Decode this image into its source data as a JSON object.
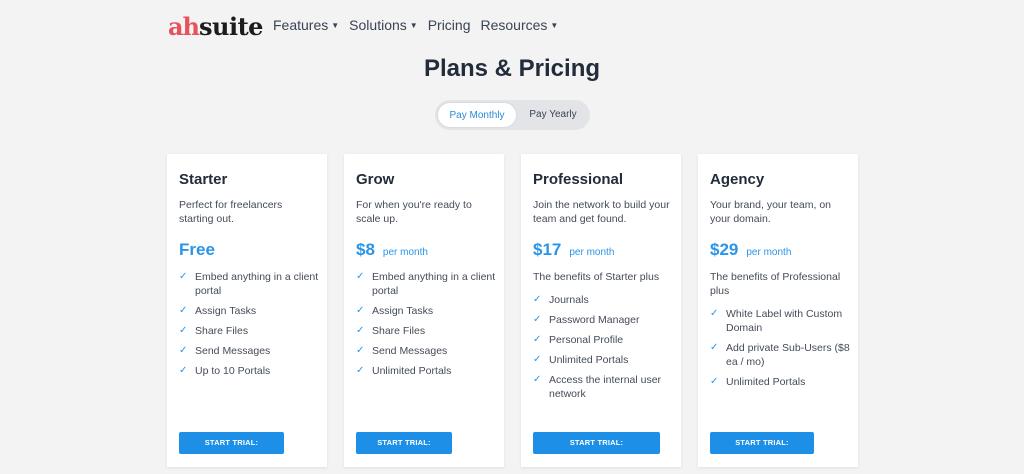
{
  "header": {
    "logo_mark": "ah",
    "logo_text": "suite",
    "nav": [
      {
        "label": "Features",
        "has_caret": true
      },
      {
        "label": "Solutions",
        "has_caret": true
      },
      {
        "label": "Pricing",
        "has_caret": false
      },
      {
        "label": "Resources",
        "has_caret": true
      }
    ]
  },
  "page_title": "Plans & Pricing",
  "billing_toggle": {
    "monthly_label": "Pay Monthly",
    "yearly_label": "Pay Yearly",
    "selected": "monthly"
  },
  "plans": [
    {
      "name": "Starter",
      "description": "Perfect for freelancers starting out.",
      "price": "Free",
      "period": "",
      "benefits_intro": "",
      "features": [
        "Embed anything in a client portal",
        "Assign Tasks",
        "Share Files",
        "Send Messages",
        "Up to 10 Portals"
      ],
      "cta": "START TRIAL: STARTER"
    },
    {
      "name": "Grow",
      "description": "For when you're ready to scale up.",
      "price": "$8",
      "period": "per month",
      "benefits_intro": "",
      "features": [
        "Embed anything in a client portal",
        "Assign Tasks",
        "Share Files",
        "Send Messages",
        "Unlimited Portals"
      ],
      "cta": "START TRIAL: GROW"
    },
    {
      "name": "Professional",
      "description": "Join the network to build your team and get found.",
      "price": "$17",
      "period": "per month",
      "benefits_intro": "The benefits of Starter plus",
      "features": [
        "Journals",
        "Password Manager",
        "Personal Profile",
        "Unlimited Portals",
        "Access the internal user network"
      ],
      "cta": "START TRIAL: PROFESSIONAL"
    },
    {
      "name": "Agency",
      "description": "Your brand, your team, on your domain.",
      "price": "$29",
      "period": "per month",
      "benefits_intro": "The benefits of Professional plus",
      "features": [
        "White Label with Custom Domain",
        "Add private Sub-Users ($8 ea / mo)",
        "Unlimited Portals"
      ],
      "cta": "START TRIAL: AGENCY"
    }
  ]
}
